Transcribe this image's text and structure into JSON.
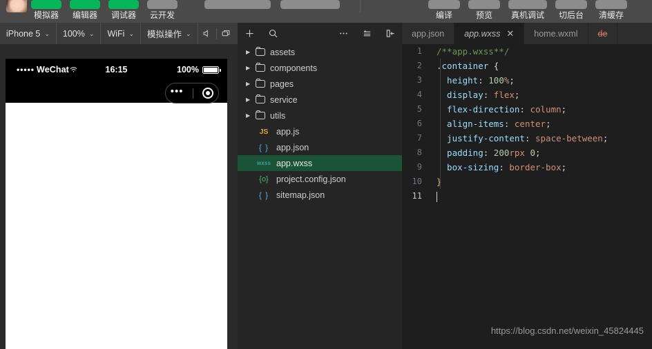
{
  "topbar": {
    "avatar_name": "user-avatar",
    "left_buttons": [
      {
        "label": "模拟器",
        "chip": "green"
      },
      {
        "label": "编辑器",
        "chip": "green"
      },
      {
        "label": "调试器",
        "chip": "green"
      },
      {
        "label": "云开发",
        "chip": "gray"
      }
    ],
    "mid_buttons": [
      {
        "label": "",
        "chip": "gray"
      },
      {
        "label": "",
        "chip": "gray"
      }
    ],
    "right_buttons": [
      {
        "label": "编译",
        "chip": "gray"
      },
      {
        "label": "预览",
        "chip": "gray"
      },
      {
        "label": "真机调试",
        "chip": "gray"
      },
      {
        "label": "切后台",
        "chip": "gray"
      },
      {
        "label": "清缓存",
        "chip": "gray"
      }
    ]
  },
  "simbar": {
    "device": "iPhone 5",
    "zoom": "100%",
    "network": "WiFi",
    "simulate": "模拟操作",
    "caret": "⌄",
    "icons": [
      {
        "name": "mute-icon",
        "glyph": "◁"
      },
      {
        "name": "screen-icon",
        "glyph": "❐"
      }
    ]
  },
  "filebar": {
    "icons": [
      {
        "name": "add-file-icon",
        "glyph": "+"
      },
      {
        "name": "search-icon",
        "glyph": "⌕"
      },
      {
        "name": "more-options-icon",
        "glyph": "···"
      },
      {
        "name": "outline-icon",
        "glyph": "≛"
      },
      {
        "name": "collapse-panel-icon",
        "glyph": "⇤"
      }
    ]
  },
  "simulator": {
    "status": {
      "signal_dots": "•••••",
      "carrier": "WeChat",
      "wifi": "⌃",
      "time": "16:15",
      "battery_percent": "100%"
    },
    "capsule": {
      "menu": "•••",
      "target": "◉"
    }
  },
  "filetree": {
    "folders": [
      {
        "name": "assets",
        "arrow": "▶"
      },
      {
        "name": "components",
        "arrow": "▶"
      },
      {
        "name": "pages",
        "arrow": "▶"
      },
      {
        "name": "service",
        "arrow": "▶"
      },
      {
        "name": "utils",
        "arrow": "▶"
      }
    ],
    "files": [
      {
        "name": "app.js",
        "icon": "JS",
        "icon_class": "fi-js",
        "active": false
      },
      {
        "name": "app.json",
        "icon": "{ }",
        "icon_class": "fi-json",
        "active": false
      },
      {
        "name": "app.wxss",
        "icon": "wxss",
        "icon_class": "fi-wxss",
        "active": true
      },
      {
        "name": "project.config.json",
        "icon": "{o}",
        "icon_class": "fi-cfg",
        "active": false
      },
      {
        "name": "sitemap.json",
        "icon": "{ }",
        "icon_class": "fi-json",
        "active": false
      }
    ]
  },
  "editor": {
    "tabs": [
      {
        "label": "app.json",
        "active": false,
        "closable": false,
        "strike": false
      },
      {
        "label": "app.wxss",
        "active": true,
        "closable": true,
        "close_glyph": "✕",
        "strike": false
      },
      {
        "label": "home.wxml",
        "active": false,
        "closable": false,
        "strike": false
      },
      {
        "label": "de",
        "active": false,
        "closable": false,
        "strike": true
      }
    ],
    "file_language": "wxss",
    "lines": [
      {
        "num": "1",
        "tokens": [
          {
            "t": "/**app.wxss**/",
            "c": "c-comment"
          }
        ]
      },
      {
        "num": "2",
        "tokens": [
          {
            "t": ".container",
            "c": "c-sel"
          },
          {
            "t": " ",
            "c": "c-punc"
          },
          {
            "t": "{",
            "c": "c-punc"
          }
        ]
      },
      {
        "num": "3",
        "tokens": [
          {
            "t": "  height",
            "c": "c-prop"
          },
          {
            "t": ": ",
            "c": "c-punc"
          },
          {
            "t": "100",
            "c": "c-num"
          },
          {
            "t": "%",
            "c": "c-val"
          },
          {
            "t": ";",
            "c": "c-punc"
          }
        ]
      },
      {
        "num": "4",
        "tokens": [
          {
            "t": "  display",
            "c": "c-prop"
          },
          {
            "t": ": ",
            "c": "c-punc"
          },
          {
            "t": "flex",
            "c": "c-val"
          },
          {
            "t": ";",
            "c": "c-punc"
          }
        ]
      },
      {
        "num": "5",
        "tokens": [
          {
            "t": "  flex-direction",
            "c": "c-prop"
          },
          {
            "t": ": ",
            "c": "c-punc"
          },
          {
            "t": "column",
            "c": "c-val"
          },
          {
            "t": ";",
            "c": "c-punc"
          }
        ]
      },
      {
        "num": "6",
        "tokens": [
          {
            "t": "  align-items",
            "c": "c-prop"
          },
          {
            "t": ": ",
            "c": "c-punc"
          },
          {
            "t": "center",
            "c": "c-val"
          },
          {
            "t": ";",
            "c": "c-punc"
          }
        ]
      },
      {
        "num": "7",
        "tokens": [
          {
            "t": "  justify-content",
            "c": "c-prop"
          },
          {
            "t": ": ",
            "c": "c-punc"
          },
          {
            "t": "space-between",
            "c": "c-val"
          },
          {
            "t": ";",
            "c": "c-punc"
          }
        ]
      },
      {
        "num": "8",
        "tokens": [
          {
            "t": "  padding",
            "c": "c-prop"
          },
          {
            "t": ": ",
            "c": "c-punc"
          },
          {
            "t": "200",
            "c": "c-num"
          },
          {
            "t": "rpx",
            "c": "c-val"
          },
          {
            "t": " ",
            "c": "c-punc"
          },
          {
            "t": "0",
            "c": "c-num"
          },
          {
            "t": ";",
            "c": "c-punc"
          }
        ]
      },
      {
        "num": "9",
        "tokens": [
          {
            "t": "  box-sizing",
            "c": "c-prop"
          },
          {
            "t": ": ",
            "c": "c-punc"
          },
          {
            "t": "border-box",
            "c": "c-val"
          },
          {
            "t": ";",
            "c": "c-punc"
          }
        ]
      },
      {
        "num": "10",
        "tokens": [
          {
            "t": "}",
            "c": "c-brace"
          }
        ]
      },
      {
        "num": "11",
        "tokens": [],
        "cursor": true,
        "current": true
      }
    ],
    "watermark": "https://blog.csdn.net/weixin_45824445"
  }
}
